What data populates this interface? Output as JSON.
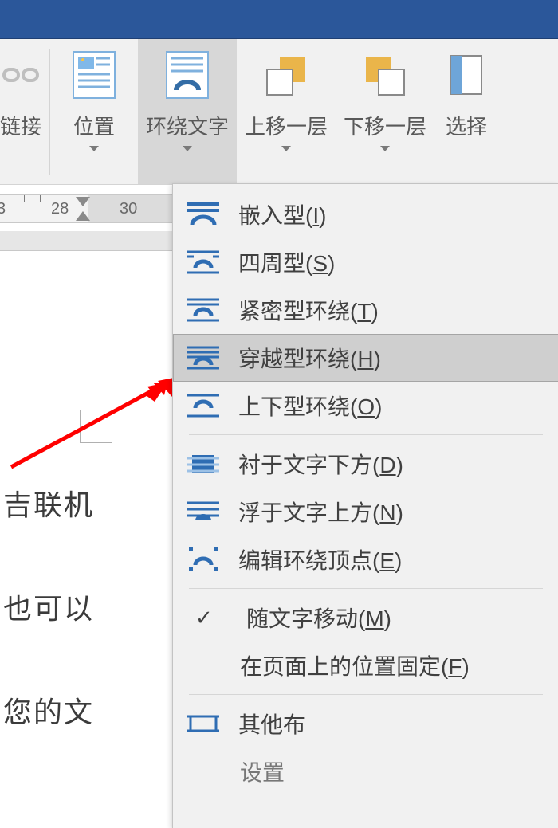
{
  "ribbon": {
    "link_label": "链接",
    "position_label": "位置",
    "wrap_label": "环绕文字",
    "bring_forward_label": "上移一层",
    "send_backward_label": "下移一层",
    "select_label": "选择"
  },
  "ruler": {
    "ticks": [
      "28",
      "30"
    ],
    "partial": "3"
  },
  "doc": {
    "line1": "吉联机",
    "line2": "也可以",
    "line3": "您的文"
  },
  "menu": {
    "inline": {
      "label": "嵌入型",
      "hotkey": "I"
    },
    "square": {
      "label": "四周型",
      "hotkey": "S"
    },
    "tight": {
      "label": "紧密型环绕",
      "hotkey": "T"
    },
    "through": {
      "label": "穿越型环绕",
      "hotkey": "H"
    },
    "topbottom": {
      "label": "上下型环绕",
      "hotkey": "O"
    },
    "behind": {
      "label": "衬于文字下方",
      "hotkey": "D"
    },
    "front": {
      "label": "浮于文字上方",
      "hotkey": "N"
    },
    "editpoints": {
      "label": "编辑环绕顶点",
      "hotkey": "E"
    },
    "movewithtext": {
      "label": "随文字移动",
      "hotkey": "M"
    },
    "fixposition": {
      "label": "在页面上的位置固定",
      "hotkey": "F"
    },
    "other": {
      "label": "其他布"
    },
    "set": {
      "label": "设置"
    }
  }
}
